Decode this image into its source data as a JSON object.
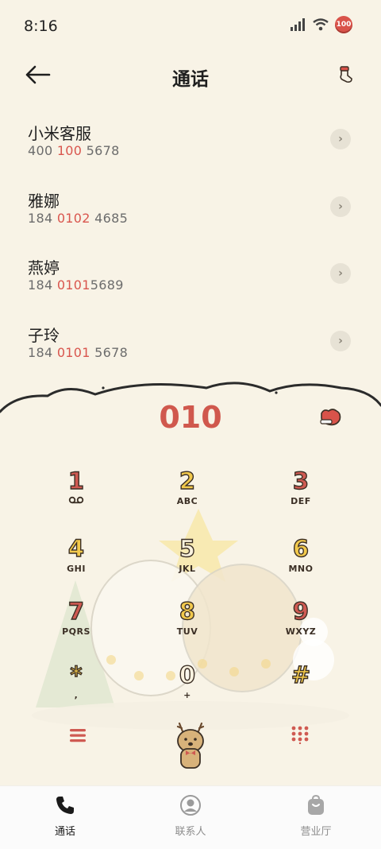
{
  "status_bar": {
    "time": "8:16",
    "battery": "100"
  },
  "header": {
    "title": "通话"
  },
  "results": [
    {
      "name": "小米客服",
      "num_parts": [
        "400 ",
        "100",
        " 5678"
      ]
    },
    {
      "name": "雅娜",
      "num_parts": [
        "184 ",
        "0102",
        " 4685"
      ]
    },
    {
      "name": "燕婷",
      "num_parts": [
        "184 ",
        "0101",
        "5689"
      ]
    },
    {
      "name": "子玲",
      "num_parts": [
        "184 ",
        "0101",
        " 5678"
      ]
    }
  ],
  "dialer": {
    "input": "010"
  },
  "keys": [
    {
      "digit": "1",
      "letters": ""
    },
    {
      "digit": "2",
      "letters": "ABC"
    },
    {
      "digit": "3",
      "letters": "DEF"
    },
    {
      "digit": "4",
      "letters": "GHI"
    },
    {
      "digit": "5",
      "letters": "JKL"
    },
    {
      "digit": "6",
      "letters": "MNO"
    },
    {
      "digit": "7",
      "letters": "PQRS"
    },
    {
      "digit": "8",
      "letters": "TUV"
    },
    {
      "digit": "9",
      "letters": "WXYZ"
    },
    {
      "digit": "*",
      "letters": ","
    },
    {
      "digit": "0",
      "letters": "+"
    },
    {
      "digit": "#",
      "letters": ""
    }
  ],
  "tabs": [
    {
      "label": "通话",
      "icon": "phone-icon",
      "active": true
    },
    {
      "label": "联系人",
      "icon": "contact-icon",
      "active": false
    },
    {
      "label": "营业厅",
      "icon": "store-bag-icon",
      "active": false
    }
  ],
  "colors": {
    "accent": "#d0584d",
    "background": "#f8f3e6",
    "digit_fill": [
      "#cf5a52",
      "#f2c94c",
      "#cf5a52",
      "#f2c94c",
      "#fbf3e0",
      "#f2c94c",
      "#cf5a52",
      "#f2c94c",
      "#cf5a52",
      "#f2c94c",
      "#fbf3e0",
      "#f2c94c"
    ]
  }
}
